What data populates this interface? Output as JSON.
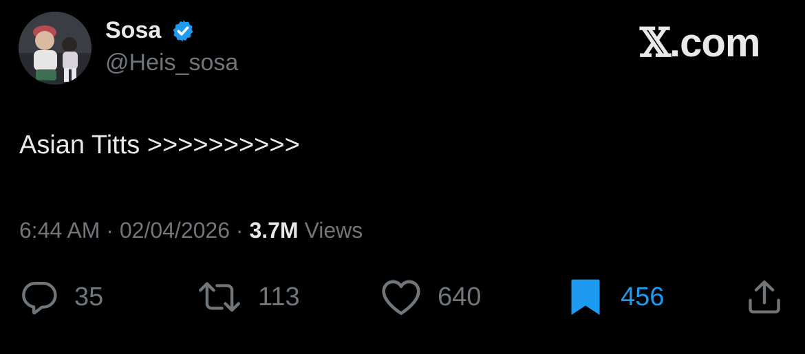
{
  "author": {
    "display_name": "Sosa",
    "handle": "@Heis_sosa",
    "verified_icon": "verified-badge-icon",
    "avatar": "avatar"
  },
  "brand": {
    "logo_glyph": "𝕏",
    "logo_suffix": ".com"
  },
  "tweet": {
    "text": "Asian Titts >>>>>>>>>>"
  },
  "meta": {
    "time": "6:44 AM",
    "separator": "·",
    "date": "02/04/2026",
    "views_count": "3.7M",
    "views_label": "Views"
  },
  "actions": {
    "reply": {
      "icon": "reply-icon",
      "count": "35"
    },
    "retweet": {
      "icon": "retweet-icon",
      "count": "113"
    },
    "like": {
      "icon": "heart-icon",
      "count": "640"
    },
    "bookmark": {
      "icon": "bookmark-icon",
      "count": "456",
      "active": true
    },
    "share": {
      "icon": "share-icon"
    }
  },
  "colors": {
    "background": "#000000",
    "primary_text": "#e7e9ea",
    "secondary_text": "#71767b",
    "accent": "#1d9bf0"
  }
}
